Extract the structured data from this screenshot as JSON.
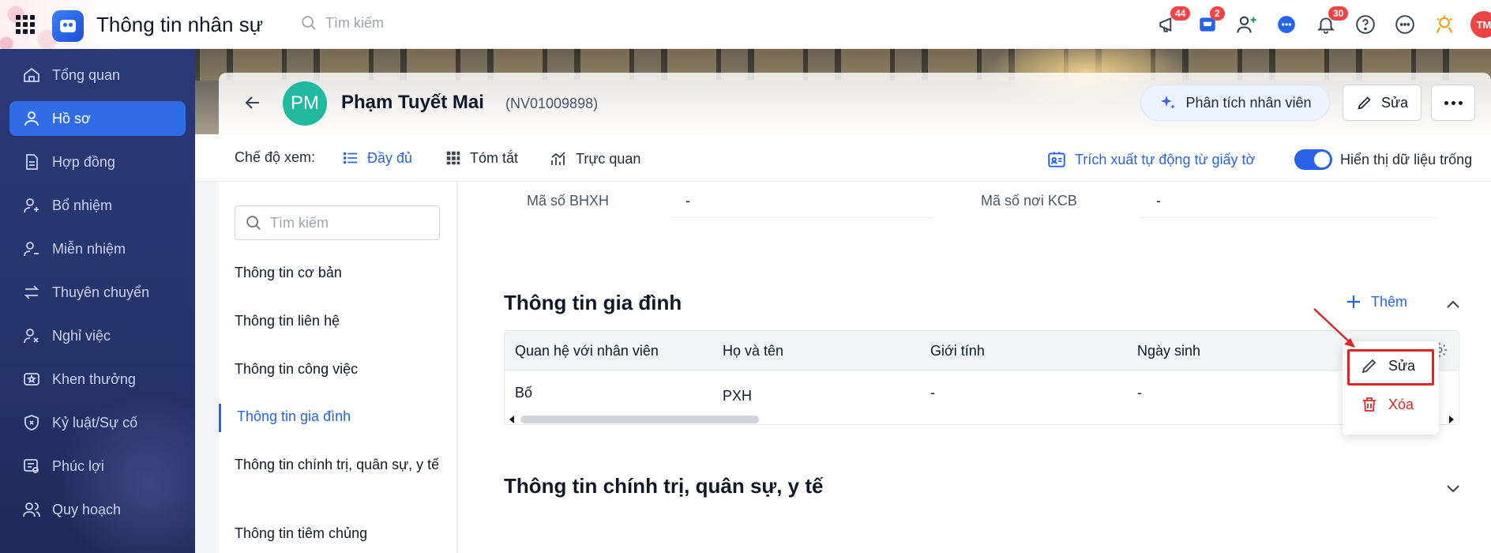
{
  "app": {
    "title": "Thông tin nhân sự",
    "search_placeholder": "Tìm kiếm",
    "avatar_initials": "TM"
  },
  "top_icons": [
    {
      "name": "megaphone-icon",
      "badge": "44"
    },
    {
      "name": "cart-icon",
      "badge": "2"
    },
    {
      "name": "add-user-icon",
      "badge": ""
    },
    {
      "name": "chat-icon",
      "badge": ""
    },
    {
      "name": "bell-icon",
      "badge": "30"
    },
    {
      "name": "help-icon",
      "badge": ""
    },
    {
      "name": "more-circle-icon",
      "badge": ""
    },
    {
      "name": "achievement-icon",
      "badge": ""
    }
  ],
  "sidebar": {
    "items": [
      {
        "label": "Tổng quan",
        "icon": "home-icon"
      },
      {
        "label": "Hồ sơ",
        "icon": "user-icon",
        "active": true
      },
      {
        "label": "Hợp đồng",
        "icon": "document-icon"
      },
      {
        "label": "Bổ nhiệm",
        "icon": "user-plus-icon"
      },
      {
        "label": "Miễn nhiệm",
        "icon": "user-minus-icon"
      },
      {
        "label": "Thuyên chuyển",
        "icon": "transfer-icon"
      },
      {
        "label": "Nghỉ việc",
        "icon": "user-x-icon"
      },
      {
        "label": "Khen thưởng",
        "icon": "award-icon"
      },
      {
        "label": "Kỷ luật/Sự cố",
        "icon": "shield-icon"
      },
      {
        "label": "Phúc lợi",
        "icon": "benefit-icon"
      },
      {
        "label": "Quy hoạch",
        "icon": "users-icon"
      }
    ]
  },
  "header": {
    "initials": "PM",
    "name": "Phạm Tuyết Mai",
    "code": "(NV01009898)",
    "analyze_label": "Phân tích nhân viên",
    "edit_label": "Sửa"
  },
  "viewbar": {
    "mode_label": "Chế độ xem:",
    "modes": [
      "Đầy đủ",
      "Tóm tắt",
      "Trực quan"
    ],
    "extract_label": "Trích xuất tự động từ giấy tờ",
    "show_empty_label": "Hiển thị dữ liệu trống"
  },
  "section_nav": {
    "search_placeholder": "Tìm kiếm",
    "items": [
      "Thông tin cơ bản",
      "Thông tin liên hệ",
      "Thông tin công việc",
      "Thông tin gia đình",
      "Thông tin chính trị, quân sự, y tế",
      "Thông tin tiêm chủng"
    ]
  },
  "fields": {
    "bhxh_label": "Mã số BHXH",
    "bhxh_value": "-",
    "kcb_label": "Mã số nơi KCB",
    "kcb_value": "-"
  },
  "family": {
    "title": "Thông tin gia đình",
    "add_label": "Thêm",
    "columns": [
      "Quan hệ với nhân viên",
      "Họ và tên",
      "Giới tính",
      "Ngày sinh"
    ],
    "rows": [
      [
        "Bố",
        "PXH",
        "-",
        "-"
      ]
    ]
  },
  "politics": {
    "title": "Thông tin chính trị, quân sự, y tế"
  },
  "popup": {
    "edit_label": "Sửa",
    "delete_label": "Xóa"
  },
  "colors": {
    "primary": "#2563eb",
    "sidebar": "#2a3a78",
    "danger": "#dc2626",
    "avatar": "#21b8a0"
  }
}
